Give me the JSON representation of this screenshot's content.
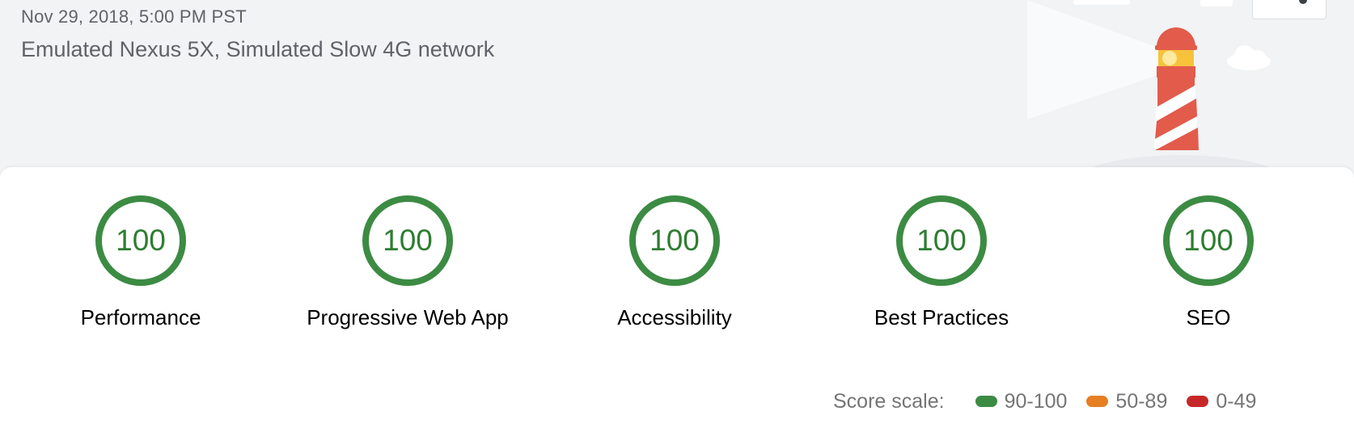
{
  "header": {
    "timestamp": "Nov 29, 2018, 5:00 PM PST",
    "environment": "Emulated Nexus 5X, Simulated Slow 4G network"
  },
  "categories": [
    {
      "name": "Performance",
      "score": "100",
      "score_fraction": 1.0
    },
    {
      "name": "Progressive Web App",
      "score": "100",
      "score_fraction": 1.0
    },
    {
      "name": "Accessibility",
      "score": "100",
      "score_fraction": 1.0
    },
    {
      "name": "Best Practices",
      "score": "100",
      "score_fraction": 1.0
    },
    {
      "name": "SEO",
      "score": "100",
      "score_fraction": 1.0
    }
  ],
  "score_scale": {
    "label": "Score scale:",
    "items": [
      {
        "range": "90-100",
        "color": "#3c8b43"
      },
      {
        "range": "50-89",
        "color": "#e67e22"
      },
      {
        "range": "0-49",
        "color": "#c62828"
      }
    ]
  },
  "colors": {
    "pass": "#2e7d32",
    "header_bg": "#f1f3f4",
    "lighthouse_red": "#e25b4b",
    "lighthouse_yellow": "#f8c33b"
  },
  "icons": {
    "share": "share-icon",
    "logo": "lighthouse-illustration"
  }
}
